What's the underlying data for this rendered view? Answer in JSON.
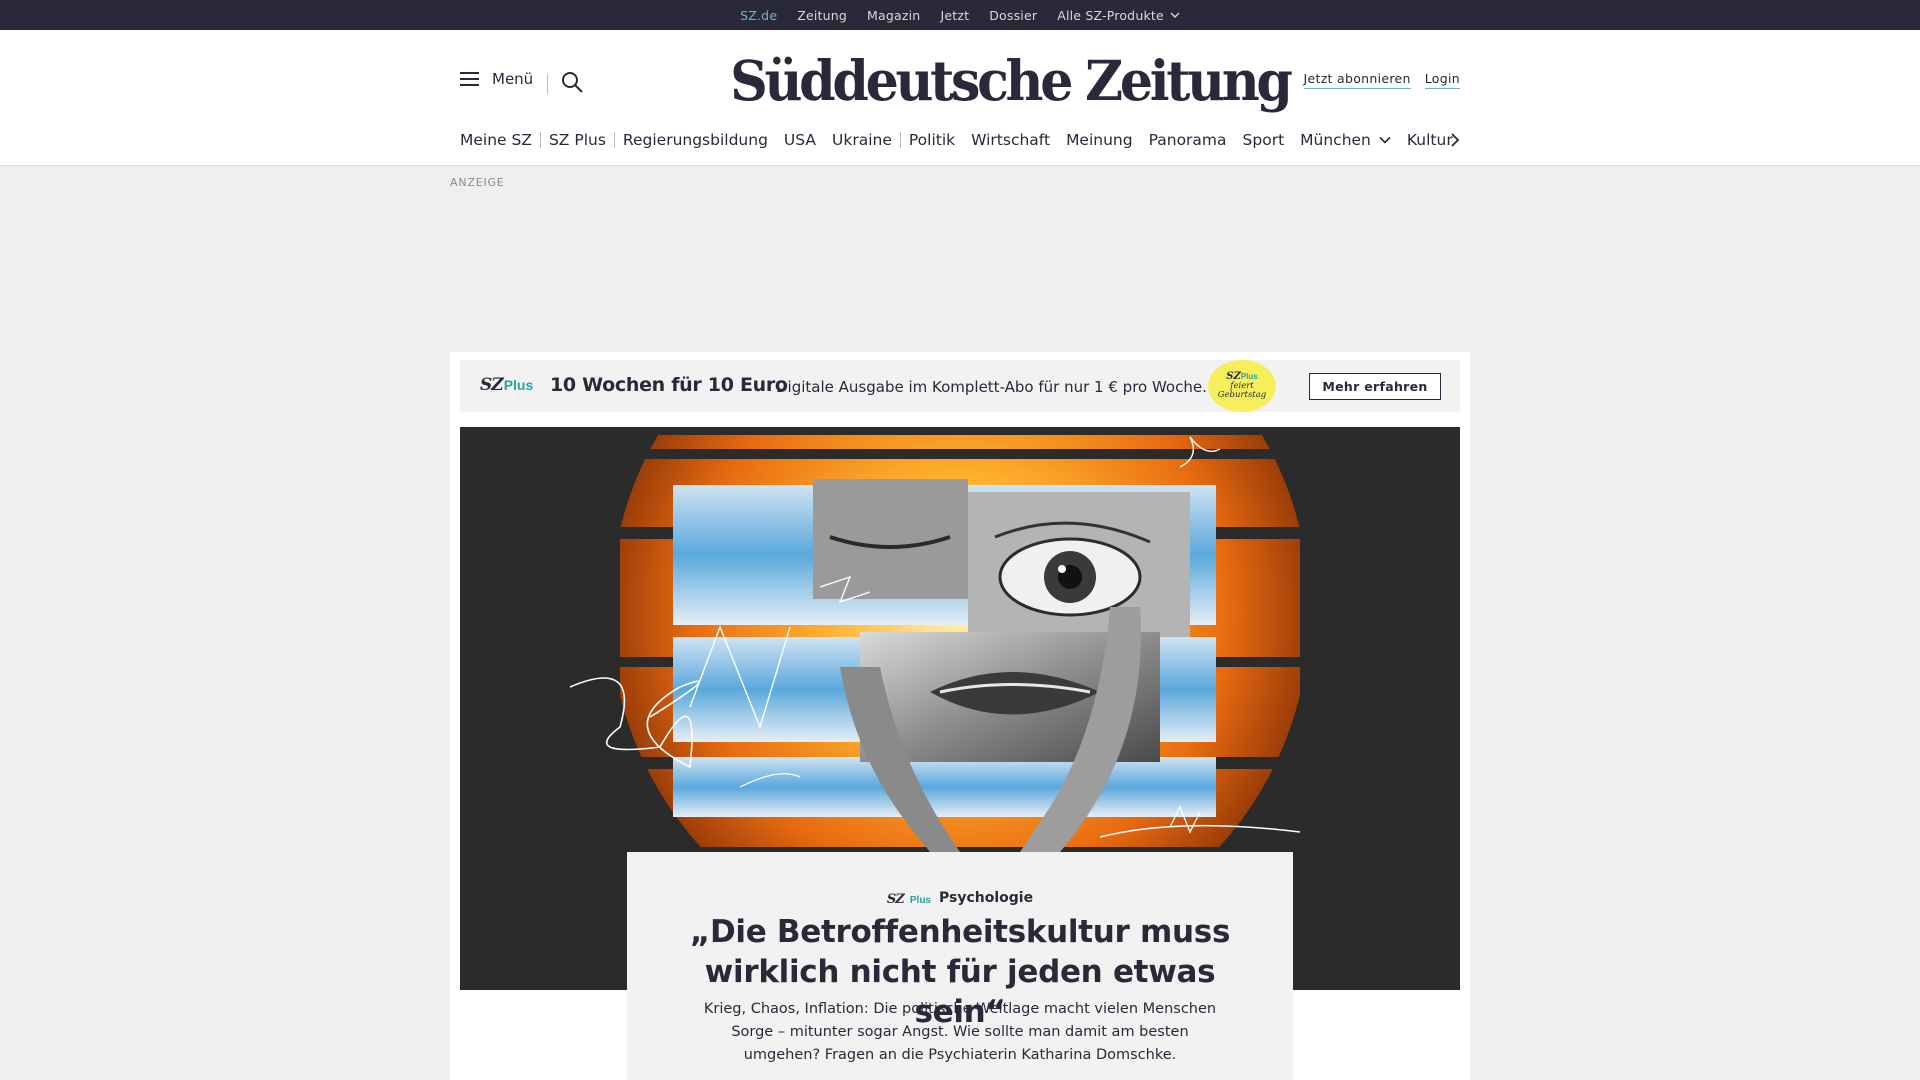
{
  "topbar": {
    "items": [
      {
        "label": "SZ.de",
        "active": true
      },
      {
        "label": "Zeitung"
      },
      {
        "label": "Magazin"
      },
      {
        "label": "Jetzt"
      },
      {
        "label": "Dossier"
      },
      {
        "label": "Alle SZ-Produkte",
        "has_dropdown": true
      }
    ]
  },
  "header": {
    "menu_label": "Menü",
    "logo_text": "Süddeutsche Zeitung",
    "subscribe_label": "Jetzt abonnieren",
    "login_label": "Login",
    "ressorts": [
      {
        "label": "Meine SZ"
      },
      {
        "label": "SZ Plus"
      },
      {
        "label": "Regierungsbildung"
      },
      {
        "label": "USA"
      },
      {
        "label": "Ukraine"
      },
      {
        "label": "Politik"
      },
      {
        "label": "Wirtschaft"
      },
      {
        "label": "Meinung"
      },
      {
        "label": "Panorama"
      },
      {
        "label": "Sport"
      },
      {
        "label": "München",
        "has_dropdown": true
      },
      {
        "label": "Kultur"
      }
    ]
  },
  "ad": {
    "label": "ANZEIGE"
  },
  "promo": {
    "brand_sz": "SZ",
    "brand_plus": "Plus",
    "headline": "10 Wochen für 10 Euro",
    "description": "Digitale Ausgabe im Komplett-Abo für nur 1 € pro Woche.",
    "badge_sz": "SZ",
    "badge_plus": "Plus",
    "badge_line1": "feiert",
    "badge_line2": "Geburtstag",
    "cta_label": "Mehr erfahren"
  },
  "article": {
    "brand_sz": "SZ",
    "brand_plus": "Plus",
    "topic": "Psychologie",
    "title": "„Die Betroffenheitskultur muss wirklich nicht für jeden etwas sein“",
    "lead": "Krieg, Chaos, Inflation: Die politische Weltlage macht vielen Menschen Sorge – mitunter sogar Angst. Wie sollte man damit am besten umgehen? Fragen an die Psychiaterin Katharina Domschke."
  },
  "colors": {
    "topbar_bg": "#29293a",
    "active_link": "#6fb2c9",
    "szplus_accent": "#29a3a3",
    "badge_yellow": "#f6ef5b"
  }
}
